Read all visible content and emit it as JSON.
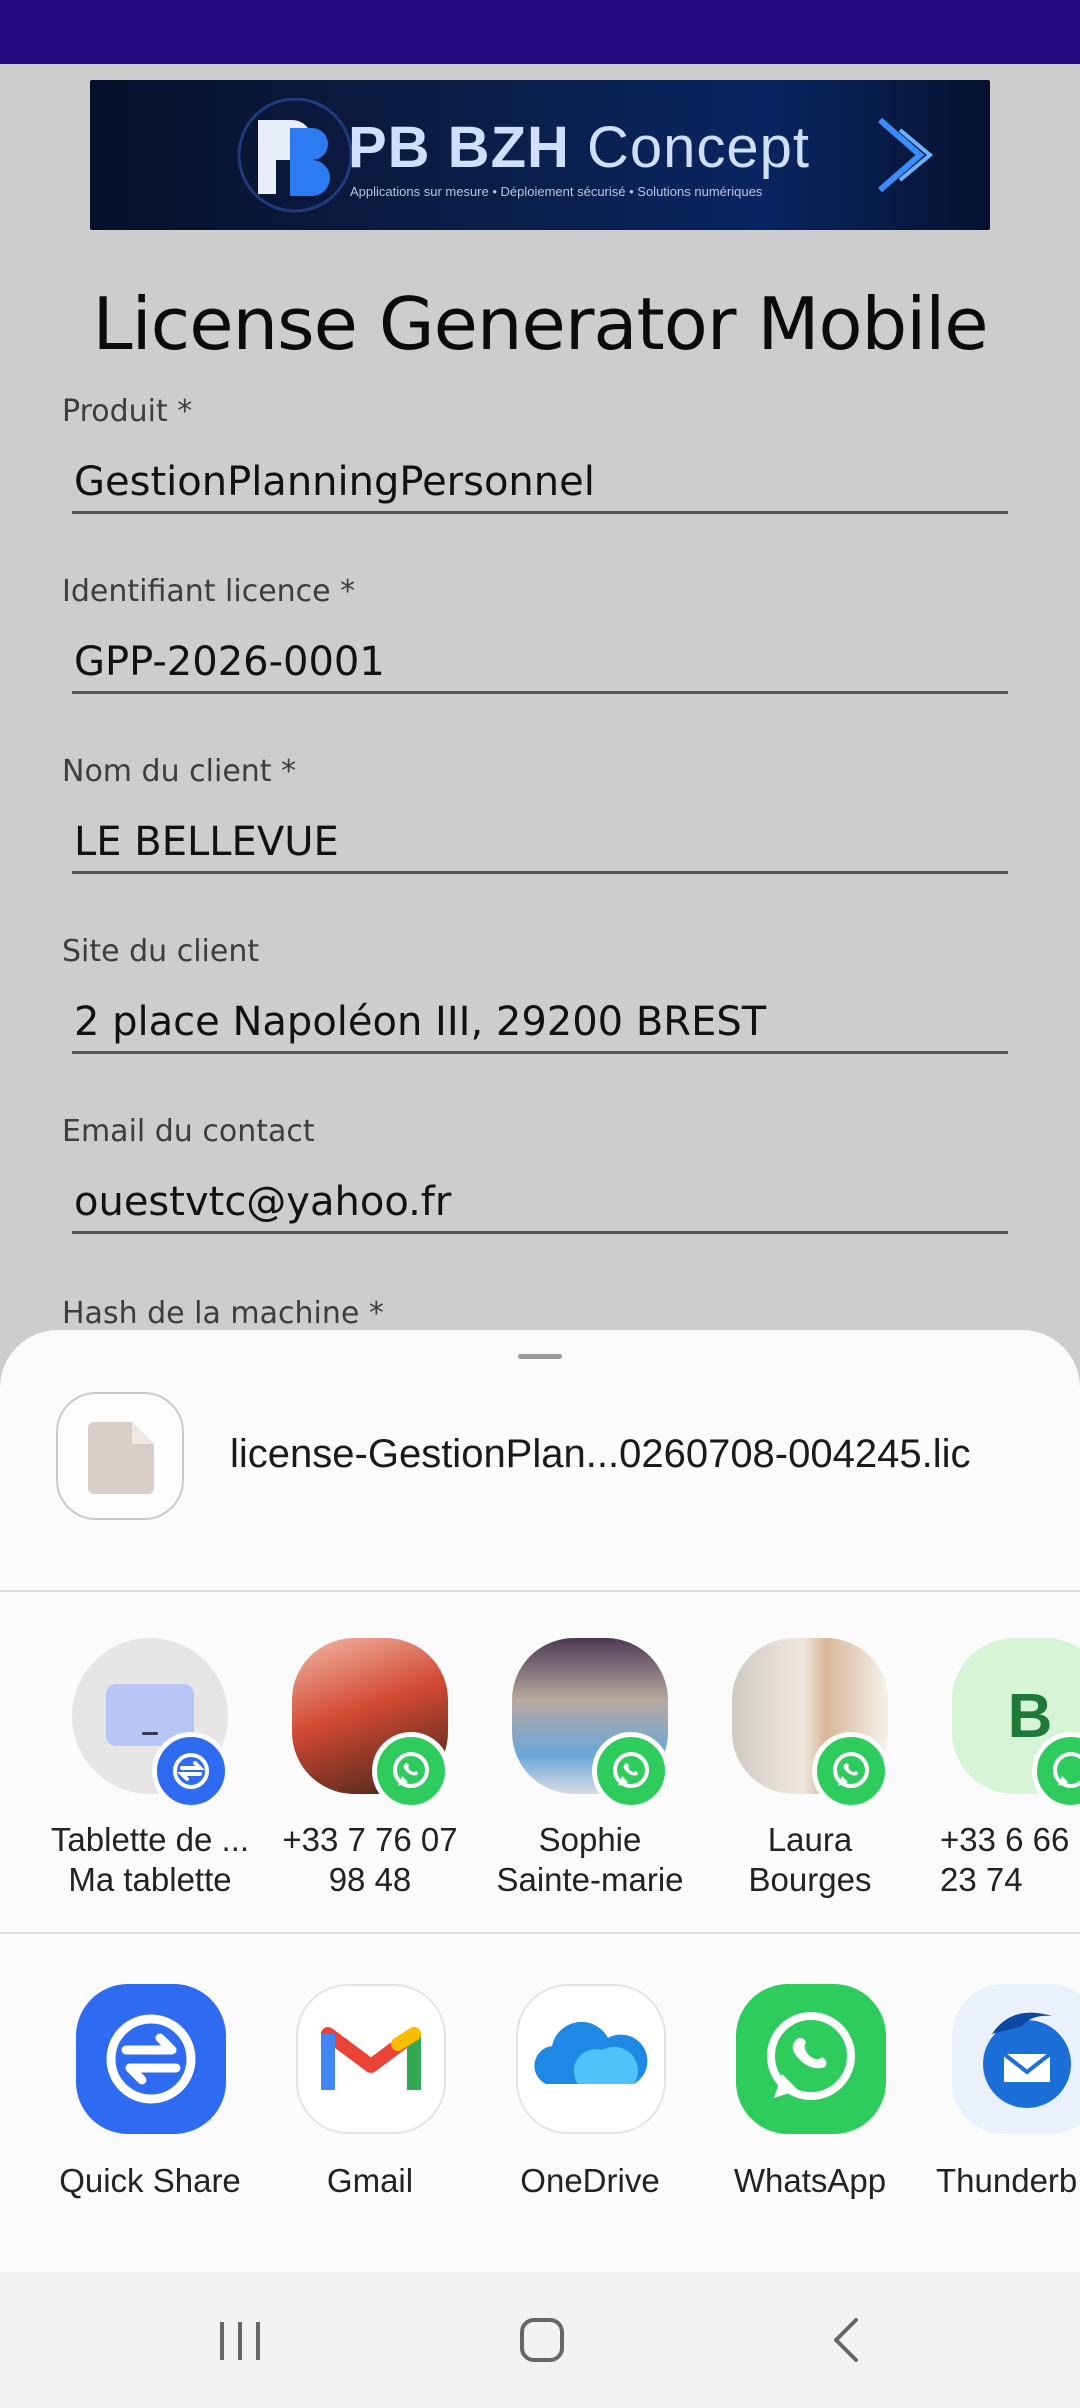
{
  "banner": {
    "title_bold": "PB BZH",
    "title_light": "Concept",
    "tagline": "Applications sur mesure • Déploiement sécurisé • Solutions numériques"
  },
  "app": {
    "title": "License Generator Mobile"
  },
  "form": {
    "product_label": "Produit *",
    "product_value": "GestionPlanningPersonnel",
    "license_id_label": "Identifiant licence *",
    "license_id_value": "GPP-2026-0001",
    "client_name_label": "Nom du client *",
    "client_name_value": "LE BELLEVUE",
    "client_site_label": "Site du client",
    "client_site_value": "2 place Napoléon III, 29200 BREST",
    "contact_email_label": "Email du contact",
    "contact_email_value": "ouestvtc@yahoo.fr",
    "machine_hash_label": "Hash de la machine *"
  },
  "share_sheet": {
    "file_name": "license-GestionPlan...0260708-004245.lic",
    "contacts": [
      {
        "name": "Tablette de ...\nMa tablette",
        "icon": "tablet-icon",
        "badge": "quick-share-icon"
      },
      {
        "name": "+33 7 76 07\n98 48",
        "icon": "contact-photo",
        "badge": "whatsapp-icon"
      },
      {
        "name": "Sophie\nSainte-marie",
        "icon": "contact-photo",
        "badge": "whatsapp-icon"
      },
      {
        "name": "Laura\nBourges",
        "icon": "contact-photo",
        "badge": "whatsapp-icon"
      },
      {
        "name": "+33 6 66\n23 74",
        "icon": "letter-avatar",
        "initial": "B",
        "badge": "whatsapp-icon"
      }
    ],
    "apps": [
      {
        "label": "Quick Share",
        "icon": "quick-share-icon"
      },
      {
        "label": "Gmail",
        "icon": "gmail-icon"
      },
      {
        "label": "OneDrive",
        "icon": "onedrive-icon"
      },
      {
        "label": "WhatsApp",
        "icon": "whatsapp-icon"
      },
      {
        "label": "Thunderb",
        "icon": "thunderbird-icon"
      }
    ]
  },
  "colors": {
    "status_bar": "#230b82",
    "whatsapp_green": "#2ecc5c",
    "quick_share_blue": "#2f6bf0"
  }
}
